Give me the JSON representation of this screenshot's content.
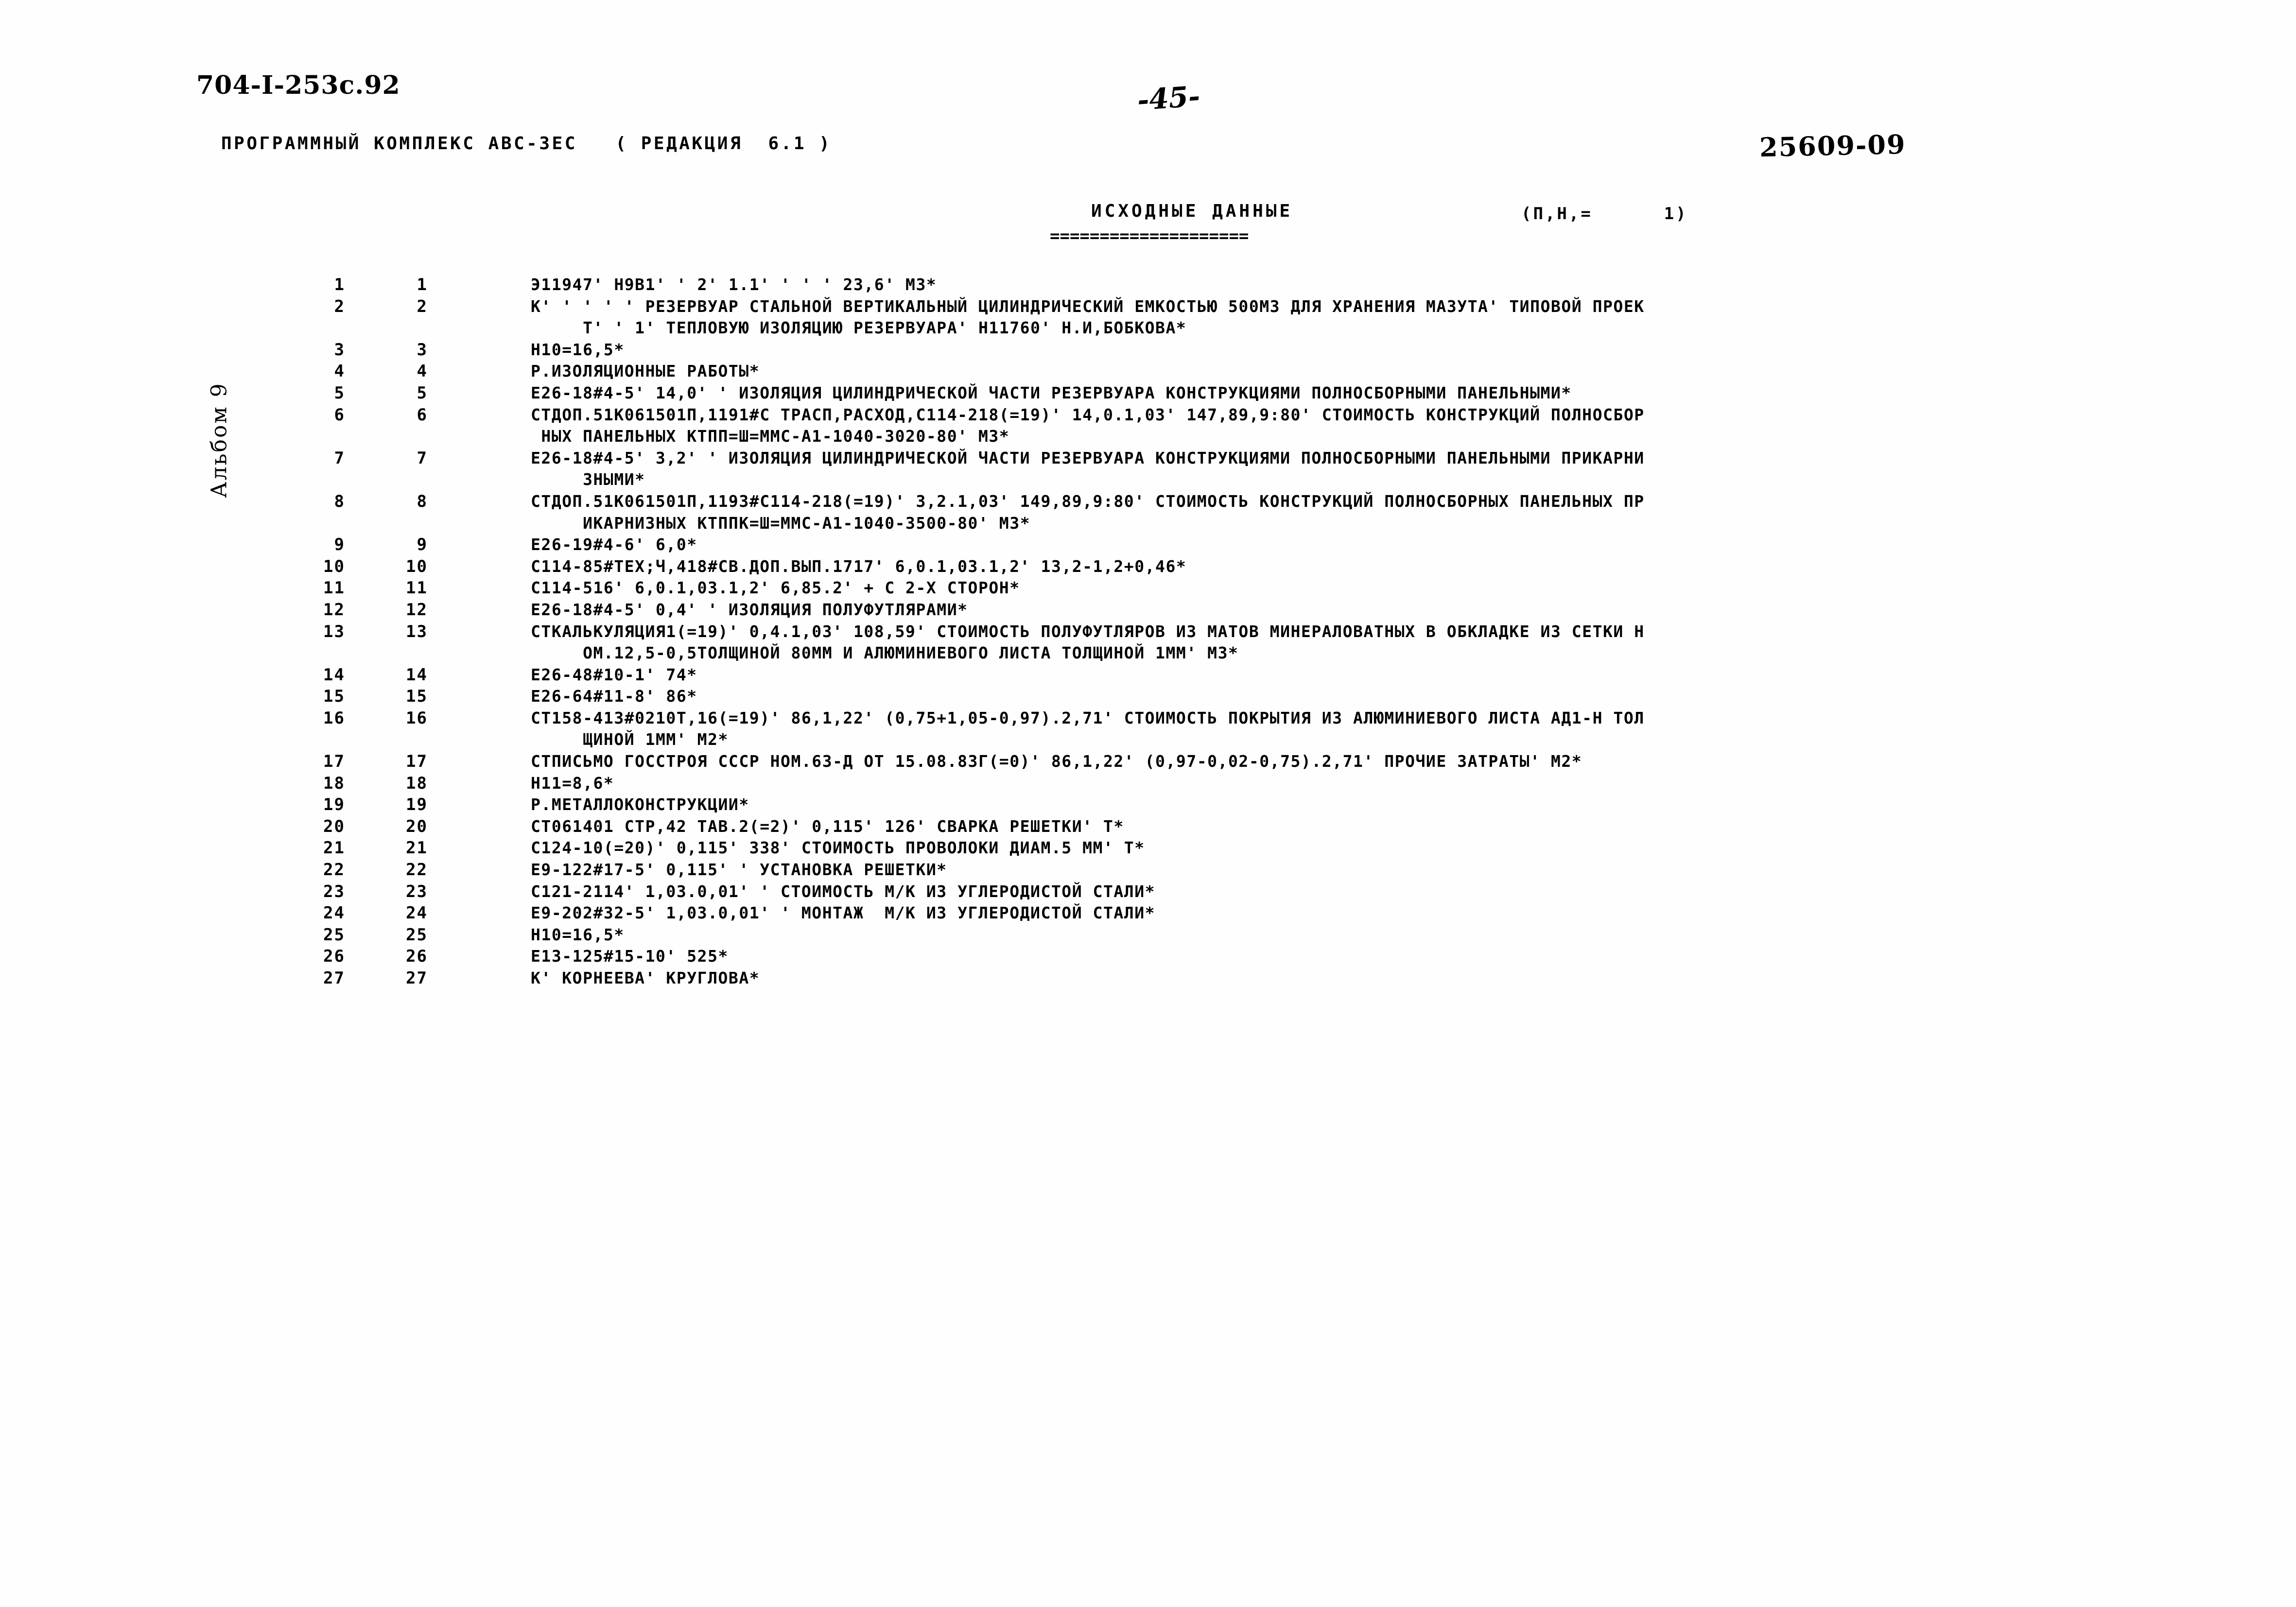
{
  "document": {
    "doc_code": "704-I-253с.92",
    "page_number": "-45-",
    "stamp_number": "25609-09",
    "album_label": "Альбом 9",
    "program_line": "ПРОГРАММНЫЙ КОМПЛЕКС АВС-ЗЕС   ( РЕДАКЦИЯ  6.1 )",
    "title": "ИСХОДНЫЕ ДАННЫЕ",
    "title_page_marker": "(П,Н,=      1)",
    "title_rule": "===================="
  },
  "listing": {
    "rows": [
      {
        "num_a": "1",
        "num_b": "1",
        "text": "Э11947' Н9В1' ' 2' 1.1' ' ' ' 23,6' М3*"
      },
      {
        "num_a": "2",
        "num_b": "2",
        "text": "К' ' ' ' ' РЕЗЕРВУАР СТАЛЬНОЙ ВЕРТИКАЛЬНЫЙ ЦИЛИНДРИЧЕСКИЙ ЕМКОСТЬЮ 500М3 ДЛЯ ХРАНЕНИЯ МАЗУТА' ТИПОВОЙ ПРОЕК"
      },
      {
        "num_a": "",
        "num_b": "",
        "text": "     Т' ' 1' ТЕПЛОВУЮ ИЗОЛЯЦИЮ РЕЗЕРВУАРА' Н11760' Н.И,БОБКОВА*",
        "cont": true
      },
      {
        "num_a": "3",
        "num_b": "3",
        "text": "Н10=16,5*"
      },
      {
        "num_a": "4",
        "num_b": "4",
        "text": "Р.ИЗОЛЯЦИОННЫЕ РАБОТЫ*"
      },
      {
        "num_a": "5",
        "num_b": "5",
        "text": "Е26-18#4-5' 14,0' ' ИЗОЛЯЦИЯ ЦИЛИНДРИЧЕСКОЙ ЧАСТИ РЕЗЕРВУАРА КОНСТРУКЦИЯМИ ПОЛНОСБОРНЫМИ ПАНЕЛЬНЫМИ*"
      },
      {
        "num_a": "6",
        "num_b": "6",
        "text": "СТДОП.51К061501П,1191#С ТРАСП,РАСХОД,С114-218(=19)' 14,0.1,03' 147,89,9:80' СТОИМОСТЬ КОНСТРУКЦИЙ ПОЛНОСБОР"
      },
      {
        "num_a": "",
        "num_b": "",
        "text": " НЫХ ПАНЕЛЬНЫХ КТПП=Ш=ММС-А1-1040-3020-80' М3*",
        "cont": true
      },
      {
        "num_a": "7",
        "num_b": "7",
        "text": "Е26-18#4-5' 3,2' ' ИЗОЛЯЦИЯ ЦИЛИНДРИЧЕСКОЙ ЧАСТИ РЕЗЕРВУАРА КОНСТРУКЦИЯМИ ПОЛНОСБОРНЫМИ ПАНЕЛЬНЫМИ ПРИКАРНИ"
      },
      {
        "num_a": "",
        "num_b": "",
        "text": "     ЗНЫМИ*",
        "cont": true
      },
      {
        "num_a": "8",
        "num_b": "8",
        "text": "СТДОП.51К061501П,1193#С114-218(=19)' 3,2.1,03' 149,89,9:80' СТОИМОСТЬ КОНСТРУКЦИЙ ПОЛНОСБОРНЫХ ПАНЕЛЬНЫХ ПР"
      },
      {
        "num_a": "",
        "num_b": "",
        "text": "     ИКАРНИЗНЫХ КТППК=Ш=ММС-А1-1040-3500-80' М3*",
        "cont": true
      },
      {
        "num_a": "9",
        "num_b": "9",
        "text": "Е26-19#4-6' 6,0*"
      },
      {
        "num_a": "10",
        "num_b": "10",
        "text": "С114-85#ТЕХ;Ч,418#СВ.ДОП.ВЫП.1717' 6,0.1,03.1,2' 13,2-1,2+0,46*"
      },
      {
        "num_a": "11",
        "num_b": "11",
        "text": "С114-516' 6,0.1,03.1,2' 6,85.2' + С 2-Х СТОРОН*"
      },
      {
        "num_a": "12",
        "num_b": "12",
        "text": "Е26-18#4-5' 0,4' ' ИЗОЛЯЦИЯ ПОЛУФУТЛЯРАМИ*"
      },
      {
        "num_a": "13",
        "num_b": "13",
        "text": "СТКАЛЬКУЛЯЦИЯ1(=19)' 0,4.1,03' 108,59' СТОИМОСТЬ ПОЛУФУТЛЯРОВ ИЗ МАТОВ МИНЕРАЛОВАТНЫХ В ОБКЛАДКЕ ИЗ СЕТКИ Н"
      },
      {
        "num_a": "",
        "num_b": "",
        "text": "     ОМ.12,5-0,5ТОЛЩИНОЙ 80ММ И АЛЮМИНИЕВОГО ЛИСТА ТОЛЩИНОЙ 1ММ' М3*",
        "cont": true
      },
      {
        "num_a": "14",
        "num_b": "14",
        "text": "Е26-48#10-1' 74*"
      },
      {
        "num_a": "15",
        "num_b": "15",
        "text": "Е26-64#11-8' 86*"
      },
      {
        "num_a": "16",
        "num_b": "16",
        "text": "СТ158-413#0210Т,16(=19)' 86,1,22' (0,75+1,05-0,97).2,71' СТОИМОСТЬ ПОКРЫТИЯ ИЗ АЛЮМИНИЕВОГО ЛИСТА АД1-Н ТОЛ"
      },
      {
        "num_a": "",
        "num_b": "",
        "text": "     ЩИНОЙ 1ММ' М2*",
        "cont": true
      },
      {
        "num_a": "17",
        "num_b": "17",
        "text": "СТПИСЬМО ГОССТРОЯ СССР НОМ.63-Д ОТ 15.08.83Г(=0)' 86,1,22' (0,97-0,02-0,75).2,71' ПРОЧИЕ ЗАТРАТЫ' М2*"
      },
      {
        "num_a": "18",
        "num_b": "18",
        "text": "Н11=8,6*"
      },
      {
        "num_a": "19",
        "num_b": "19",
        "text": "Р.МЕТАЛЛОКОНСТРУКЦИИ*"
      },
      {
        "num_a": "20",
        "num_b": "20",
        "text": "СТ061401 СТР,42 ТАВ.2(=2)' 0,115' 126' СВАРКА РЕШЕТКИ' Т*"
      },
      {
        "num_a": "21",
        "num_b": "21",
        "text": "С124-10(=20)' 0,115' 338' СТОИМОСТЬ ПРОВОЛОКИ ДИАМ.5 ММ' Т*"
      },
      {
        "num_a": "22",
        "num_b": "22",
        "text": "Е9-122#17-5' 0,115' ' УСТАНОВКА РЕШЕТКИ*"
      },
      {
        "num_a": "23",
        "num_b": "23",
        "text": "С121-2114' 1,03.0,01' ' СТОИМОСТЬ М/К ИЗ УГЛЕРОДИСТОЙ СТАЛИ*"
      },
      {
        "num_a": "24",
        "num_b": "24",
        "text": "Е9-202#32-5' 1,03.0,01' ' МОНТАЖ  М/К ИЗ УГЛЕРОДИСТОЙ СТАЛИ*"
      },
      {
        "num_a": "25",
        "num_b": "25",
        "text": "Н10=16,5*"
      },
      {
        "num_a": "26",
        "num_b": "26",
        "text": "Е13-125#15-10' 525*"
      },
      {
        "num_a": "27",
        "num_b": "27",
        "text": "К' КОРНЕЕВА' КРУГЛОВА*"
      }
    ]
  }
}
